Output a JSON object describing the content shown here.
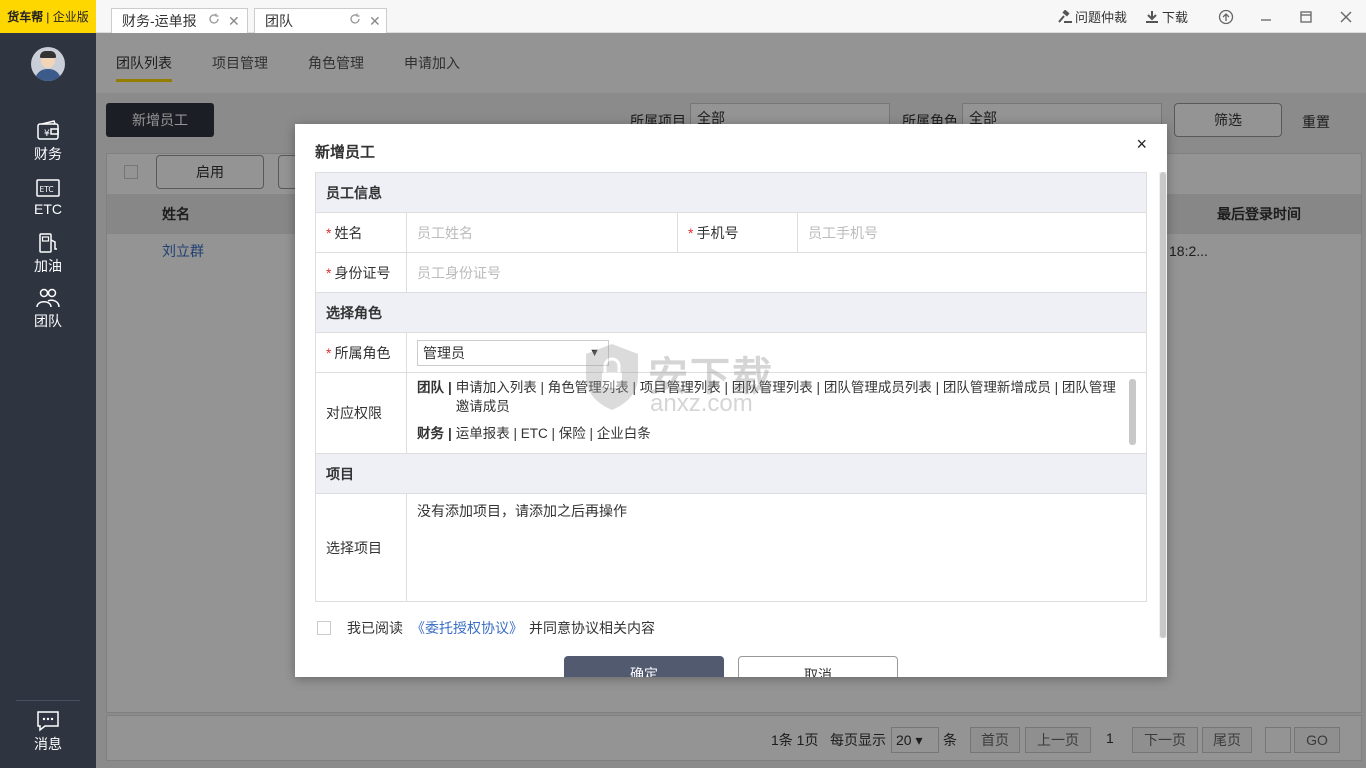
{
  "app": {
    "logo_brand": "货车帮",
    "logo_edition": "企业版"
  },
  "sidebar": {
    "items": [
      {
        "label": "财务",
        "icon": "wallet-icon"
      },
      {
        "label": "ETC",
        "icon": "etc-card-icon"
      },
      {
        "label": "加油",
        "icon": "fuel-pump-icon"
      },
      {
        "label": "团队",
        "icon": "team-icon"
      }
    ],
    "bottom": {
      "label": "消息",
      "icon": "message-icon"
    }
  },
  "tabs": [
    {
      "label": "财务-运单报",
      "active": false
    },
    {
      "label": "团队",
      "active": true
    }
  ],
  "top_actions": {
    "dispute": "问题仲裁",
    "download": "下载"
  },
  "subtabs": [
    "团队列表",
    "项目管理",
    "角色管理",
    "申请加入"
  ],
  "toolbar": {
    "add_employee": "新增员工",
    "project_label": "所属项目",
    "project_value": "全部",
    "role_label": "所属角色",
    "role_value": "全部",
    "filter": "筛选",
    "reset": "重置",
    "enable": "启用"
  },
  "table": {
    "headers": {
      "name": "姓名",
      "last_login": "最后登录时间"
    },
    "rows": [
      {
        "name": "刘立群",
        "last_login_partial": "18:2..."
      }
    ]
  },
  "pager": {
    "summary": "1条 1页",
    "per_page_label": "每页显示",
    "per_page_value": "20",
    "per_page_unit": "条",
    "first": "首页",
    "prev": "上一页",
    "current": "1",
    "next": "下一页",
    "last": "尾页",
    "go": "GO"
  },
  "modal": {
    "title": "新增员工",
    "close": "×",
    "sections": {
      "employee_info": "员工信息",
      "select_role": "选择角色",
      "project": "项目"
    },
    "fields": {
      "name_label": "姓名",
      "name_placeholder": "员工姓名",
      "phone_label": "手机号",
      "phone_placeholder": "员工手机号",
      "id_label": "身份证号",
      "id_placeholder": "员工身份证号",
      "role_label": "所属角色",
      "role_value": "管理员",
      "perm_label": "对应权限",
      "project_label": "选择项目",
      "project_empty": "没有添加项目，请添加之后再操作"
    },
    "permissions": [
      {
        "group": "团队",
        "items": "申请加入列表 | 角色管理列表 | 项目管理列表 | 团队管理列表 | 团队管理成员列表 | 团队管理新增成员 | 团队管理邀请成员"
      },
      {
        "group": "财务",
        "items": "运单报表 | ETC | 保险 | 企业白条"
      }
    ],
    "agreement": {
      "prefix": "我已阅读",
      "link": "《委托授权协议》",
      "suffix": "并同意协议相关内容"
    },
    "confirm": "确定",
    "cancel": "取消"
  },
  "watermark": {
    "text": "安下载",
    "domain": "anxz.com"
  }
}
